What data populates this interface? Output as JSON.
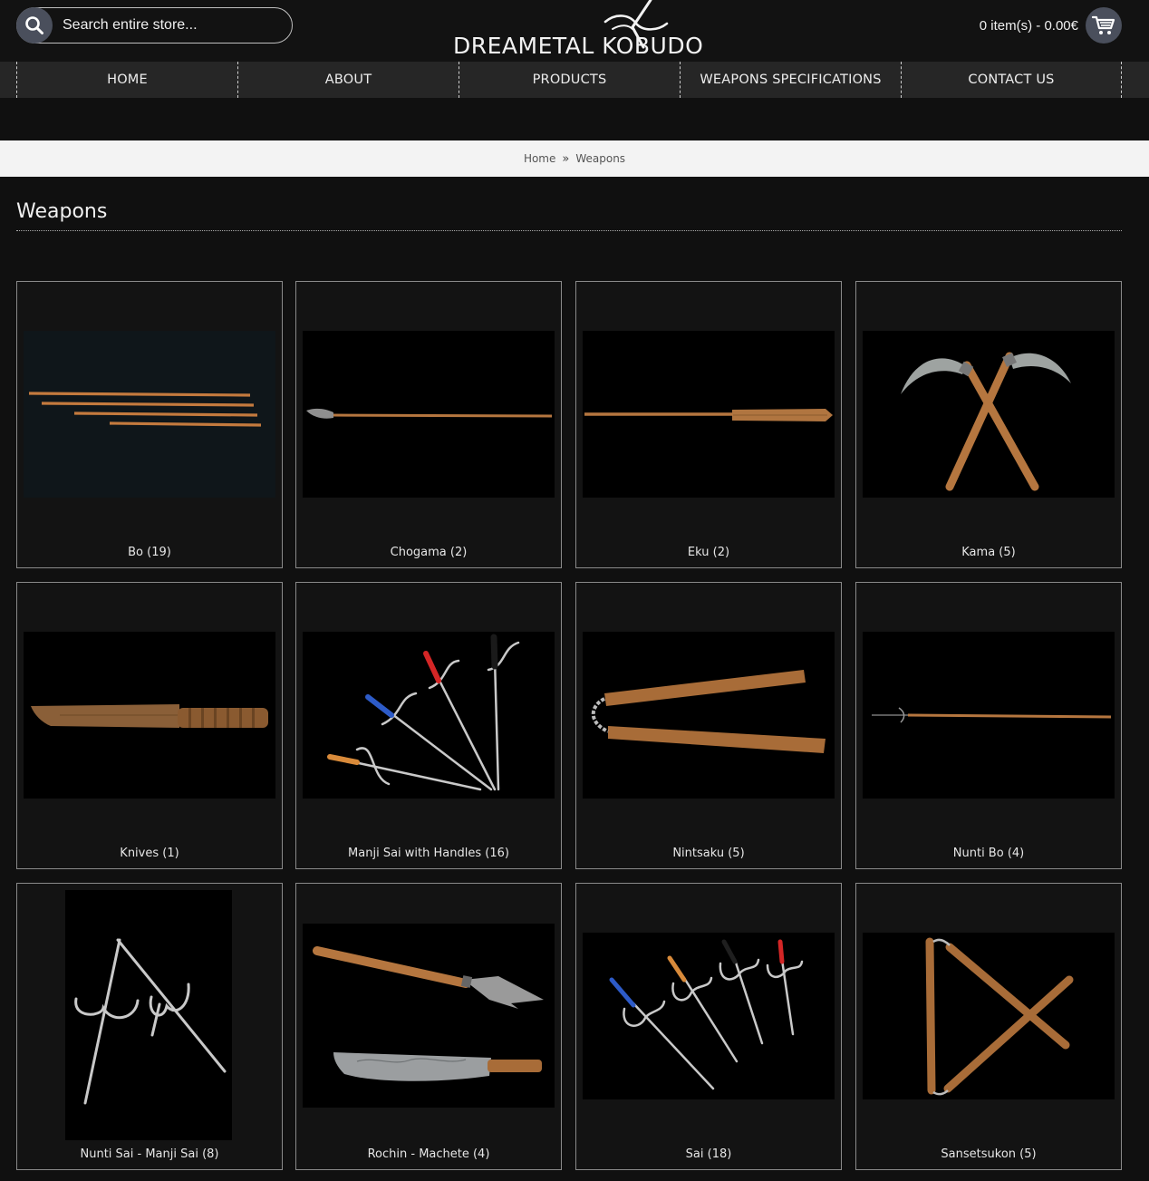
{
  "header": {
    "search_placeholder": "Search entire store...",
    "logo_text": "DREAMETAL KOBUDO",
    "cart_summary": "0 item(s) - 0.00€"
  },
  "nav": {
    "items": [
      {
        "label": "HOME"
      },
      {
        "label": "ABOUT"
      },
      {
        "label": "PRODUCTS"
      },
      {
        "label": "WEAPONS SPECIFICATIONS"
      },
      {
        "label": "CONTACT US"
      }
    ]
  },
  "breadcrumb": {
    "home": "Home",
    "separator": "»",
    "current": "Weapons"
  },
  "page": {
    "title": "Weapons"
  },
  "categories": [
    {
      "label": "Bo (19)"
    },
    {
      "label": "Chogama (2)"
    },
    {
      "label": "Eku (2)"
    },
    {
      "label": "Kama (5)"
    },
    {
      "label": "Knives (1)"
    },
    {
      "label": "Manji Sai with Handles (16)"
    },
    {
      "label": "Nintsaku (5)"
    },
    {
      "label": "Nunti Bo (4)"
    },
    {
      "label": "Nunti Sai - Manji Sai (8)"
    },
    {
      "label": "Rochin - Machete (4)"
    },
    {
      "label": "Sai (18)"
    },
    {
      "label": "Sansetsukon (5)"
    }
  ],
  "colors": {
    "background": "#101010",
    "nav_background": "#262626",
    "icon_button": "#4a4f5c",
    "breadcrumb_bar": "#f3f3f3",
    "wood": "#b5763f",
    "steel": "#c9c9c9"
  }
}
